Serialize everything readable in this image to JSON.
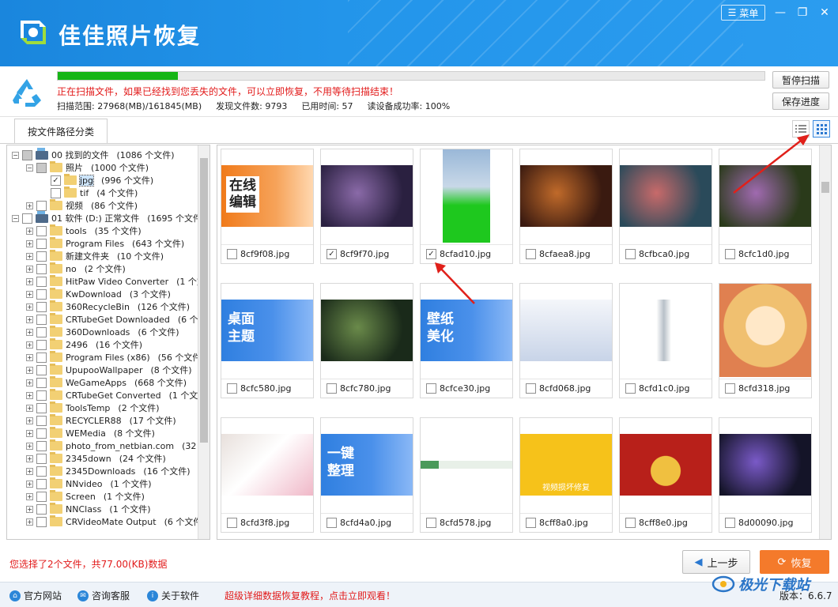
{
  "app": {
    "title": "佳佳照片恢复",
    "menu_label": "菜单"
  },
  "scan": {
    "progress": 0.17,
    "message": "正在扫描文件，如果已经找到您丢失的文件，可以立即恢复，不用等待扫描结束！",
    "range": "扫描范围: 27968(MB)/161845(MB)",
    "found": "发现文件数: 9793",
    "elapsed": "已用时间: 57",
    "read_rate": "读设备成功率: 100%",
    "pause_label": "暂停扫描",
    "save_label": "保存进度"
  },
  "tabs": {
    "by_path": "按文件路径分类"
  },
  "tree": [
    {
      "level": 0,
      "exp": "−",
      "check": "partial",
      "icon": "drive",
      "name": "00 找到的文件",
      "count": "(1086 个文件)"
    },
    {
      "level": 1,
      "exp": "−",
      "check": "partial",
      "icon": "folder",
      "name": "照片",
      "count": "(1000 个文件)"
    },
    {
      "level": 2,
      "exp": "",
      "check": "checked",
      "icon": "folder",
      "name": "jpg",
      "count": "(996 个文件)",
      "selected": true
    },
    {
      "level": 2,
      "exp": "",
      "check": "none",
      "icon": "folder",
      "name": "tif",
      "count": "(4 个文件)"
    },
    {
      "level": 1,
      "exp": "+",
      "check": "none",
      "icon": "folder",
      "name": "视频",
      "count": "(86 个文件)"
    },
    {
      "level": 0,
      "exp": "−",
      "check": "none",
      "icon": "drive",
      "name": "01 软件 (D:) 正常文件",
      "count": "(1695 个文件"
    },
    {
      "level": 1,
      "exp": "+",
      "check": "none",
      "icon": "folder",
      "name": "tools",
      "count": "(35 个文件)"
    },
    {
      "level": 1,
      "exp": "+",
      "check": "none",
      "icon": "folder",
      "name": "Program Files",
      "count": "(643 个文件)"
    },
    {
      "level": 1,
      "exp": "+",
      "check": "none",
      "icon": "folder",
      "name": "新建文件夹",
      "count": "(10 个文件)"
    },
    {
      "level": 1,
      "exp": "+",
      "check": "none",
      "icon": "folder",
      "name": "no",
      "count": "(2 个文件)"
    },
    {
      "level": 1,
      "exp": "+",
      "check": "none",
      "icon": "folder",
      "name": "HitPaw Video Converter",
      "count": "(1 个文"
    },
    {
      "level": 1,
      "exp": "+",
      "check": "none",
      "icon": "folder",
      "name": "KwDownload",
      "count": "(3 个文件)"
    },
    {
      "level": 1,
      "exp": "+",
      "check": "none",
      "icon": "folder",
      "name": "360RecycleBin",
      "count": "(126 个文件)"
    },
    {
      "level": 1,
      "exp": "+",
      "check": "none",
      "icon": "folder",
      "name": "CRTubeGet Downloaded",
      "count": "(6 个文"
    },
    {
      "level": 1,
      "exp": "+",
      "check": "none",
      "icon": "folder",
      "name": "360Downloads",
      "count": "(6 个文件)"
    },
    {
      "level": 1,
      "exp": "+",
      "check": "none",
      "icon": "folder",
      "name": "2496",
      "count": "(16 个文件)"
    },
    {
      "level": 1,
      "exp": "+",
      "check": "none",
      "icon": "folder",
      "name": "Program Files (x86)",
      "count": "(56 个文件"
    },
    {
      "level": 1,
      "exp": "+",
      "check": "none",
      "icon": "folder",
      "name": "UpupooWallpaper",
      "count": "(8 个文件)"
    },
    {
      "level": 1,
      "exp": "+",
      "check": "none",
      "icon": "folder",
      "name": "WeGameApps",
      "count": "(668 个文件)"
    },
    {
      "level": 1,
      "exp": "+",
      "check": "none",
      "icon": "folder",
      "name": "CRTubeGet Converted",
      "count": "(1 个文"
    },
    {
      "level": 1,
      "exp": "+",
      "check": "none",
      "icon": "folder",
      "name": "ToolsTemp",
      "count": "(2 个文件)"
    },
    {
      "level": 1,
      "exp": "+",
      "check": "none",
      "icon": "folder",
      "name": "RECYCLER88",
      "count": "(17 个文件)"
    },
    {
      "level": 1,
      "exp": "+",
      "check": "none",
      "icon": "folder",
      "name": "WEMedia",
      "count": "(8 个文件)"
    },
    {
      "level": 1,
      "exp": "+",
      "check": "none",
      "icon": "folder",
      "name": "photo_from_netbian.com",
      "count": "(32 个"
    },
    {
      "level": 1,
      "exp": "+",
      "check": "none",
      "icon": "folder",
      "name": "2345down",
      "count": "(24 个文件)"
    },
    {
      "level": 1,
      "exp": "+",
      "check": "none",
      "icon": "folder",
      "name": "2345Downloads",
      "count": "(16 个文件)"
    },
    {
      "level": 1,
      "exp": "+",
      "check": "none",
      "icon": "folder",
      "name": "NNvideo",
      "count": "(1 个文件)"
    },
    {
      "level": 1,
      "exp": "+",
      "check": "none",
      "icon": "folder",
      "name": "Screen",
      "count": "(1 个文件)"
    },
    {
      "level": 1,
      "exp": "+",
      "check": "none",
      "icon": "folder",
      "name": "NNClass",
      "count": "(1 个文件)"
    },
    {
      "level": 1,
      "exp": "+",
      "check": "none",
      "icon": "folder",
      "name": "CRVideoMate Output",
      "count": "(6 个文件"
    }
  ],
  "files": [
    {
      "name": "8cf9f08.jpg",
      "checked": false,
      "thumb": "orange-banner",
      "caption": "在线\n编辑",
      "colors": [
        "#f07a1a",
        "#ffffff"
      ]
    },
    {
      "name": "8cf9f70.jpg",
      "checked": true,
      "thumb": "dark-art",
      "colors": [
        "#2a2040",
        "#8a6aa8"
      ]
    },
    {
      "name": "8cfad10.jpg",
      "checked": true,
      "thumb": "portrait-green",
      "colors": [
        "#9ab8d8",
        "#1ec81e"
      ]
    },
    {
      "name": "8cfaea8.jpg",
      "checked": false,
      "thumb": "dark-art",
      "colors": [
        "#3a1a10",
        "#c06a2a"
      ]
    },
    {
      "name": "8cfbca0.jpg",
      "checked": false,
      "thumb": "dark-art",
      "colors": [
        "#2a4a5a",
        "#c86a6a"
      ]
    },
    {
      "name": "8cfc1d0.jpg",
      "checked": false,
      "thumb": "dark-art",
      "colors": [
        "#2a3a1a",
        "#a06ab0"
      ]
    },
    {
      "name": "8cfc580.jpg",
      "checked": false,
      "thumb": "blue-banner",
      "caption": "桌面\n主题",
      "colors": [
        "#2f7fe0",
        "#ffffff"
      ]
    },
    {
      "name": "8cfc780.jpg",
      "checked": false,
      "thumb": "dark-art",
      "colors": [
        "#1a2a1a",
        "#6a8a4a"
      ]
    },
    {
      "name": "8cfce30.jpg",
      "checked": false,
      "thumb": "blue-banner",
      "caption": "壁纸\n美化",
      "colors": [
        "#2f7fe0",
        "#ffffff"
      ]
    },
    {
      "name": "8cfd068.jpg",
      "checked": false,
      "thumb": "light-web",
      "colors": [
        "#f4f6fa",
        "#c8d4e8"
      ]
    },
    {
      "name": "8cfd1c0.jpg",
      "checked": false,
      "thumb": "white-product",
      "colors": [
        "#ffffff",
        "#b8c0c8"
      ]
    },
    {
      "name": "8cfd318.jpg",
      "checked": false,
      "thumb": "anime",
      "colors": [
        "#f0c070",
        "#e08050"
      ]
    },
    {
      "name": "8cfd3f8.jpg",
      "checked": false,
      "thumb": "photo-pink",
      "colors": [
        "#e8e0dc",
        "#f0b8c8"
      ]
    },
    {
      "name": "8cfd4a0.jpg",
      "checked": false,
      "thumb": "blue-banner",
      "caption": "一键\n整理",
      "colors": [
        "#2f7fe0",
        "#ffffff"
      ]
    },
    {
      "name": "8cfd578.jpg",
      "checked": false,
      "thumb": "strip",
      "colors": [
        "#ffffff",
        "#4a9a5a"
      ]
    },
    {
      "name": "8cff8a0.jpg",
      "checked": false,
      "thumb": "yellow-video",
      "caption": "视频损坏修复",
      "colors": [
        "#f6c21a",
        "#2a7ae0"
      ]
    },
    {
      "name": "8cff8e0.jpg",
      "checked": false,
      "thumb": "red-game",
      "colors": [
        "#b8201a",
        "#f0c040"
      ]
    },
    {
      "name": "8d00090.jpg",
      "checked": false,
      "thumb": "dark-art",
      "colors": [
        "#141428",
        "#7a5ac8"
      ]
    }
  ],
  "bottom": {
    "selection": "您选择了2个文件，共77.00(KB)数据",
    "prev_label": "上一步",
    "recover_label": "恢复"
  },
  "footer": {
    "site": "官方网站",
    "support": "咨询客服",
    "about": "关于软件",
    "tutorial": "超级详细数据恢复教程，点击立即观看！",
    "version": "版本：6.6.7"
  },
  "watermark": "极光下载站"
}
